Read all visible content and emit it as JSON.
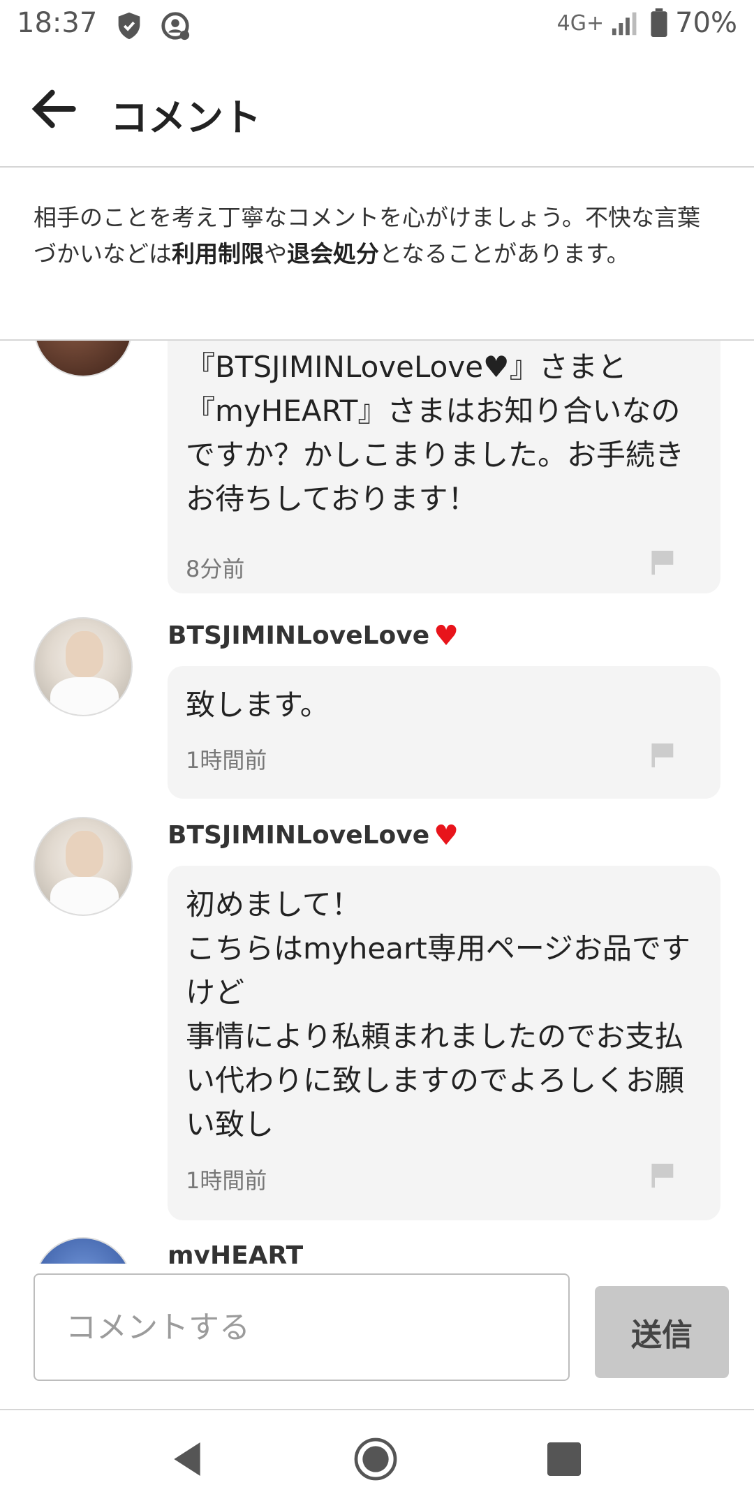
{
  "status_bar": {
    "time": "18:37",
    "network": "4G+",
    "battery": "70%"
  },
  "header": {
    "title": "コメント"
  },
  "notice": {
    "text_1": "相手のことを考え丁寧なコメントを心がけましょう。不快な言葉づかいなどは",
    "bold_1": "利用制限",
    "text_2": "や",
    "bold_2": "退会処分",
    "text_3": "となることがあります。"
  },
  "comments": [
    {
      "user": "",
      "body": "『BTSJIMINLoveLove♥』さまと『myHEART』さまはお知り合いなのですか？かしこまりました。お手続きお待ちしております！",
      "time": "8分前"
    },
    {
      "user": "BTSJIMINLoveLove",
      "body": "致します。",
      "time": "1時間前"
    },
    {
      "user": "BTSJIMINLoveLove",
      "body": "初めまして！\nこちらはmyheart専用ページお品ですけど\n事情により私頼まれましたのでお支払い代わりに致しますのでよろしくお願い致し",
      "time": "1時間前"
    },
    {
      "user": "myHEART",
      "body": "",
      "time": ""
    }
  ],
  "input": {
    "placeholder": "コメントする",
    "send_label": "送信"
  },
  "colors": {
    "heart": "#e8141b",
    "bubble": "#f4f4f4",
    "send_button": "#c8c8c8"
  }
}
